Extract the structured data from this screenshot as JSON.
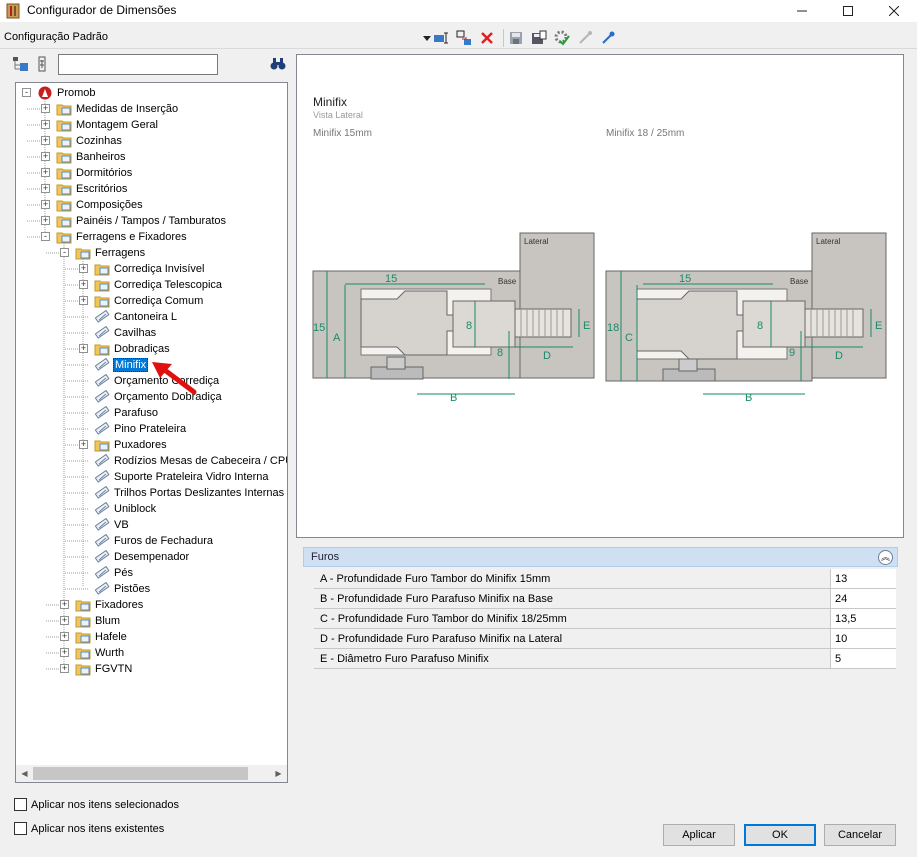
{
  "window": {
    "title": "Configurador de Dimensões"
  },
  "toolbar": {
    "config_label": "Configuração Padrão"
  },
  "tree": {
    "search_value": "",
    "root": "Promob",
    "categories": [
      "Medidas de Inserção",
      "Montagem Geral",
      "Cozinhas",
      "Banheiros",
      "Dormitórios",
      "Escritórios",
      "Composições",
      "Painéis / Tampos / Tamburatos",
      "Ferragens e Fixadores"
    ],
    "ferragens": "Ferragens",
    "ferragens_children": [
      "Corrediça Invisível",
      "Corrediça Telescopica",
      "Corrediça Comum",
      "Cantoneira L",
      "Cavilhas",
      "Dobradiças",
      "Minifix",
      "Orçamento Corrediça",
      "Orçamento Dobradiça",
      "Parafuso",
      "Pino Prateleira",
      "Puxadores",
      "Rodízios Mesas de Cabeceira / CPU",
      "Suporte Prateleira Vidro Interna",
      "Trilhos Portas Deslizantes Internas L",
      "Uniblock",
      "VB",
      "Furos de Fechadura",
      "Desempenador",
      "Pés",
      "Pistões"
    ],
    "vendors": [
      "Fixadores",
      "Blum",
      "Hafele",
      "Wurth",
      "FGVTN"
    ],
    "selected": "Minifix"
  },
  "preview": {
    "title": "Minifix",
    "subtitle": "Vista Lateral",
    "caption_left": "Minifix 15mm",
    "caption_right": "Minifix 18 / 25mm",
    "diagram": {
      "lateral_label": "Lateral",
      "base_label": "Base",
      "left": {
        "top_dim": "15",
        "thickness": "15",
        "letter_a": "A",
        "center_dim": "8",
        "edge_dim": "8",
        "letter_b": "B",
        "letter_d": "D",
        "letter_e": "E"
      },
      "right": {
        "top_dim": "15",
        "thickness": "18",
        "letter_c": "C",
        "center_dim": "8",
        "edge_dim": "9",
        "letter_b": "B",
        "letter_d": "D",
        "letter_e": "E"
      }
    }
  },
  "properties": {
    "section_title": "Furos",
    "rows": [
      {
        "label": "A - Profundidade Furo Tambor do Minifix 15mm",
        "value": "13"
      },
      {
        "label": "B - Profundidade Furo Parafuso Minifix na Base",
        "value": "24"
      },
      {
        "label": "C - Profundidade Furo Tambor do Minifix 18/25mm",
        "value": "13,5"
      },
      {
        "label": "D - Profundidade Furo Parafuso Minifix na Lateral",
        "value": "10"
      },
      {
        "label": "E - Diâmetro Furo Parafuso Minifix",
        "value": "5"
      }
    ]
  },
  "options": {
    "apply_selected": "Aplicar nos itens selecionados",
    "apply_existing": "Aplicar nos itens existentes"
  },
  "buttons": {
    "apply": "Aplicar",
    "ok": "OK",
    "cancel": "Cancelar"
  },
  "colors": {
    "dimension": "#1a8a6a",
    "panel": "#c8c5c0",
    "selection": "#0078d7",
    "annotation_arrow": "#e01010"
  }
}
